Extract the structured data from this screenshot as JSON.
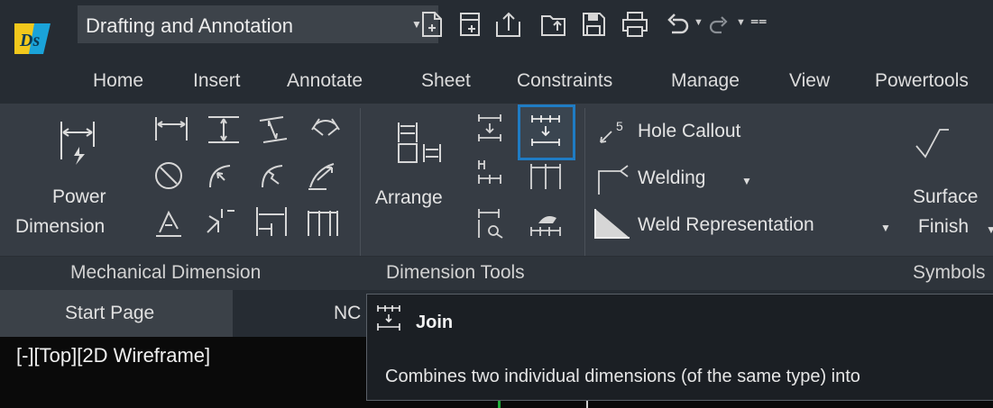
{
  "app": {
    "logo_text": "Ds",
    "accent": "#1f7cc4"
  },
  "workspace": {
    "label": "Drafting and Annotation"
  },
  "quick_access": [
    "new-icon",
    "new-sheet-icon",
    "export-icon",
    "open-icon",
    "save-icon",
    "print-icon",
    "undo-icon",
    "redo-icon",
    "customize-icon"
  ],
  "tabs": [
    "Home",
    "Insert",
    "Annotate",
    "Sheet",
    "Constraints",
    "Manage",
    "View",
    "Powertools"
  ],
  "ribbon": {
    "power_dimension_line1": "Power",
    "power_dimension_line2": "Dimension",
    "arrange_label": "Arrange",
    "hole_callout": "Hole Callout",
    "hole_callout_superscript": "5",
    "welding": "Welding",
    "weld_representation": "Weld Representation",
    "surface_finish_line1": "Surface",
    "surface_finish_line2": "Finish"
  },
  "groups": {
    "mechanical_dimension": "Mechanical Dimension",
    "dimension_tools": "Dimension Tools",
    "symbols": "Symbols"
  },
  "document_tabs": {
    "start_page": "Start Page",
    "second_tab": "NC"
  },
  "viewport": {
    "label": "[-][Top][2D Wireframe]"
  },
  "tooltip": {
    "title": "Join",
    "description": "Combines two individual dimensions (of the same type) into"
  }
}
